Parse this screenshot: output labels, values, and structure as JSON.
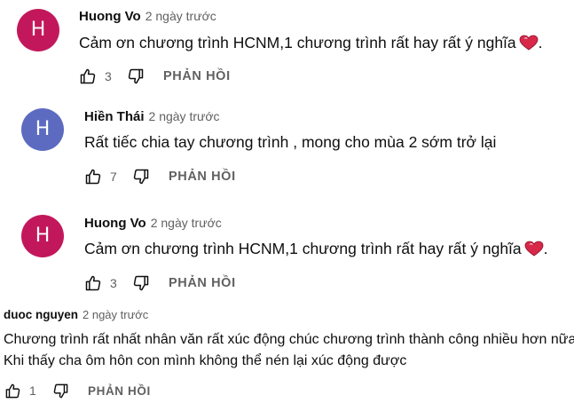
{
  "comments": [
    {
      "avatar_letter": "H",
      "avatar_color": "#c2185b",
      "author": "Huong Vo",
      "time": "2 ngày trước",
      "lines": [
        "Cảm ơn chương trình HCNM,1 chương trình rất hay rất ý nghĩa"
      ],
      "suffix": ".",
      "emoji": "heart-icon",
      "likes": "3",
      "reply_label": "PHẢN HỒI"
    },
    {
      "avatar_letter": "H",
      "avatar_color": "#5c6bc0",
      "author": "Hiền Thái",
      "time": "2 ngày trước",
      "lines": [
        "Rất tiếc chia tay chương trình , mong cho mùa 2 sớm trở lại"
      ],
      "likes": "7",
      "reply_label": "PHẢN HỒI"
    },
    {
      "avatar_letter": "H",
      "avatar_color": "#c2185b",
      "author": "Huong Vo",
      "time": "2 ngày trước",
      "lines": [
        "Cảm ơn chương trình HCNM,1 chương trình rất hay rất ý nghĩa"
      ],
      "suffix": ".",
      "emoji": "heart-icon",
      "likes": "3",
      "reply_label": "PHẢN HỒI"
    },
    {
      "author": "duoc nguyen",
      "time": "2 ngày trước",
      "lines": [
        "Chương trình rất nhất nhân văn rất xúc động chúc chương trình thành công nhiều hơn nữa",
        "Khi thấy cha ôm hôn con mình không thể nén lại xúc động được"
      ],
      "likes": "1",
      "reply_label": "PHẢN HỒI"
    }
  ],
  "colors": {
    "text_primary": "#0f0f0f",
    "text_secondary": "#606060",
    "heart": "#d8284a"
  }
}
